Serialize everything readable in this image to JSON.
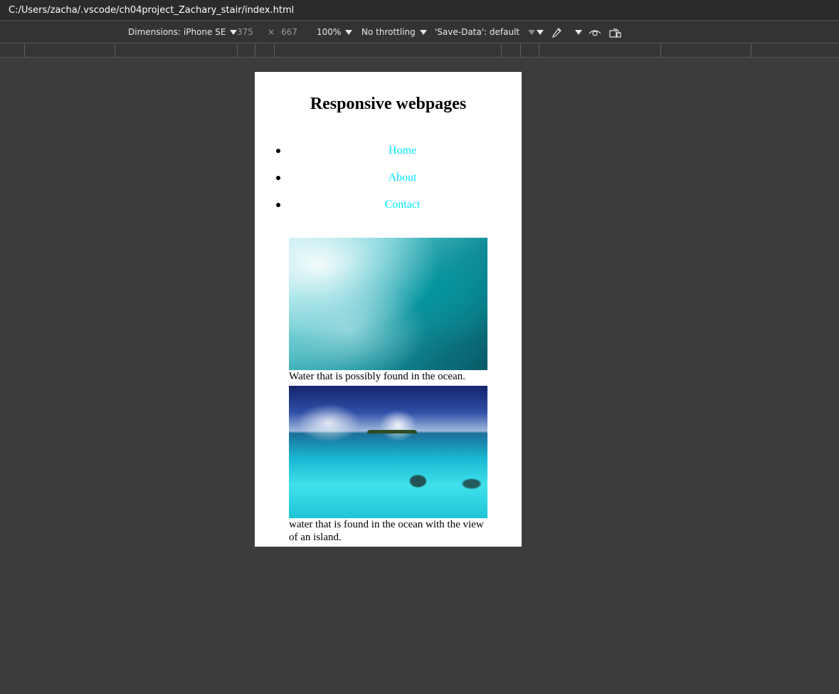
{
  "address_bar": {
    "url": "C:/Users/zacha/.vscode/ch04project_Zachary_stair/index.html"
  },
  "toolbar": {
    "dimensions_label": "Dimensions: iPhone SE",
    "width": "375",
    "times": "×",
    "height": "667",
    "zoom": "100%",
    "throttling": "No throttling",
    "save_data": "'Save-Data': default",
    "icons": [
      "eyedropper-icon",
      "eye-icon",
      "rotate-icon"
    ]
  },
  "page": {
    "title": "Responsive webpages",
    "nav": [
      {
        "label": "Home"
      },
      {
        "label": "About"
      },
      {
        "label": "Contact"
      }
    ],
    "figures": [
      {
        "caption": "Water that is possibly found in the ocean."
      },
      {
        "caption": "water that is found in the ocean with the view of an island."
      }
    ],
    "link_color": "#00e5ff"
  }
}
